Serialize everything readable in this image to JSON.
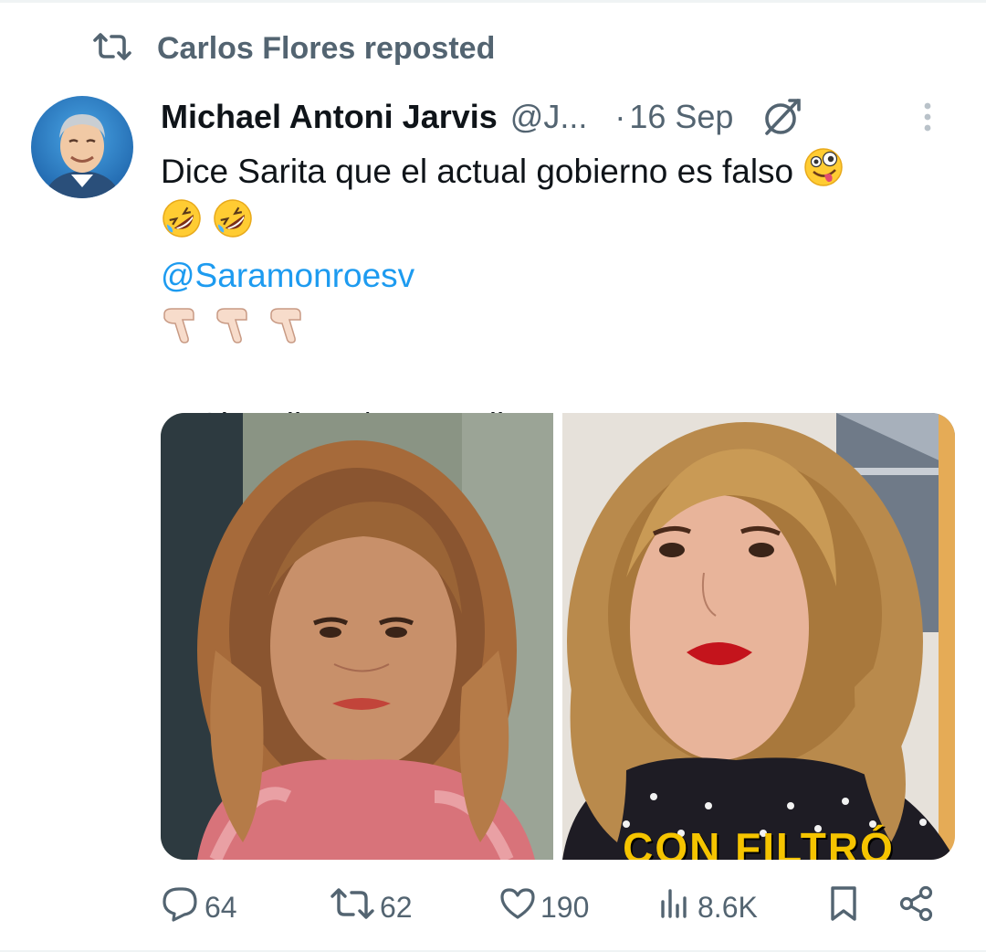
{
  "repost": {
    "icon": "repost-icon",
    "label": "Carlos Flores reposted"
  },
  "tweet": {
    "author_name": "Michael Antoni Jarvis",
    "author_handle": "@J...",
    "separator": "·",
    "date": "16 Sep",
    "avatar_icon": "avatar",
    "grok_icon": "grok-icon",
    "more_icon": "more-vertical-icon",
    "text_line1": "Dice Sarita que el actual gobierno es falso",
    "mention": "@Saramonroesv",
    "caption": "Sin  Filtro  /  Con  Filtro",
    "emojis": {
      "zany": "zany-face-emoji",
      "rofl": "rolling-on-floor-laughing-emoji",
      "pointing": "backhand-index-pointing-down-emoji"
    },
    "media": [
      {
        "name": "photo-sin-filtro"
      },
      {
        "name": "photo-con-filtro",
        "overlay_text": "CON FILTRÓ"
      }
    ]
  },
  "actions": {
    "reply": {
      "icon": "reply-icon",
      "count": "64"
    },
    "repost": {
      "icon": "repost-icon",
      "count": "62"
    },
    "like": {
      "icon": "heart-icon",
      "count": "190"
    },
    "views": {
      "icon": "views-icon",
      "count": "8.6K"
    },
    "bookmark": {
      "icon": "bookmark-icon"
    },
    "share": {
      "icon": "share-icon"
    }
  },
  "colors": {
    "text": "#0f1419",
    "secondary": "#536471",
    "link": "#1d9bf0"
  }
}
